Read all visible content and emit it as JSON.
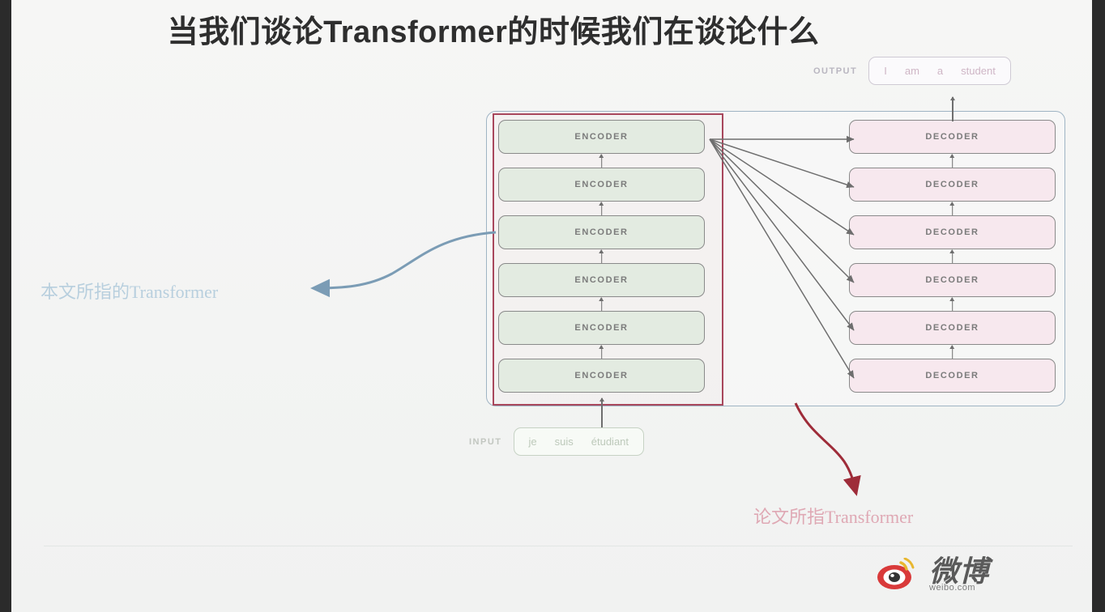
{
  "slide": {
    "title": "当我们谈论Transformer的时候我们在谈论什么"
  },
  "diagram": {
    "encoder_stack": {
      "name": "encoder-stack",
      "count": 6,
      "label": "ENCODER",
      "fill_color": "#e3ebe1",
      "items": [
        {
          "label": "ENCODER"
        },
        {
          "label": "ENCODER"
        },
        {
          "label": "ENCODER"
        },
        {
          "label": "ENCODER"
        },
        {
          "label": "ENCODER"
        },
        {
          "label": "ENCODER"
        }
      ]
    },
    "decoder_stack": {
      "name": "decoder-stack",
      "count": 6,
      "label": "DECODER",
      "fill_color": "#f7e8ee",
      "items": [
        {
          "label": "DECODER"
        },
        {
          "label": "DECODER"
        },
        {
          "label": "DECODER"
        },
        {
          "label": "DECODER"
        },
        {
          "label": "DECODER"
        },
        {
          "label": "DECODER"
        }
      ]
    },
    "input": {
      "label": "INPUT",
      "tokens": [
        "je",
        "suis",
        "étudiant"
      ]
    },
    "output": {
      "label": "OUTPUT",
      "tokens": [
        "I",
        "am",
        "a",
        "student"
      ]
    },
    "highlight_box": {
      "name": "encoder-highlight-rectangle",
      "color": "#a8475c"
    },
    "outer_container": {
      "name": "transformer-outer-container",
      "color": "#9fb4c4"
    }
  },
  "annotations": [
    {
      "id": "annot-blue",
      "text": "本文所指的Transformer",
      "color": "#b8cfde",
      "arrow": "curved-arrow-left"
    },
    {
      "id": "annot-red",
      "text": "论文所指Transformer",
      "color": "#dfa8b4",
      "arrow": "curved-arrow-down"
    }
  ],
  "watermark": {
    "brand_cn": "微博",
    "url": "weibo.com",
    "logo_color": "#d93a3a"
  }
}
